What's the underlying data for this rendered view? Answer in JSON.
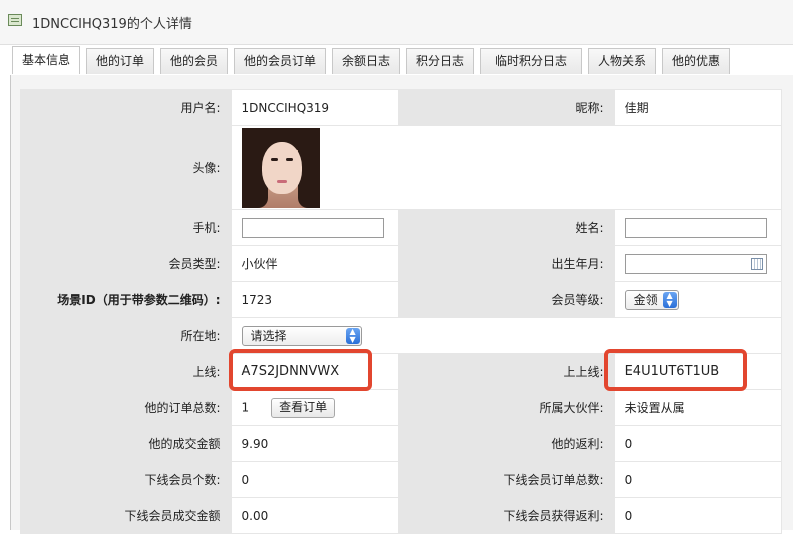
{
  "window": {
    "title": "1DNCCIHQ319的个人详情"
  },
  "tabs": [
    {
      "label": "基本信息"
    },
    {
      "label": "他的订单"
    },
    {
      "label": "他的会员"
    },
    {
      "label": "他的会员订单"
    },
    {
      "label": "余额日志"
    },
    {
      "label": "积分日志"
    },
    {
      "label": "临时积分日志"
    },
    {
      "label": "人物关系"
    },
    {
      "label": "他的优惠"
    }
  ],
  "form": {
    "username_label": "用户名:",
    "username": "1DNCCIHQ319",
    "nickname_label": "昵称:",
    "nickname": "佳期",
    "avatar_label": "头像:",
    "phone_label": "手机:",
    "phone": "",
    "name_label": "姓名:",
    "name": "",
    "type_label": "会员类型:",
    "type": "小伙伴",
    "birth_label": "出生年月:",
    "birth": "",
    "scene_label": "场景ID（用于带参数二维码）:",
    "scene": "1723",
    "level_label": "会员等级:",
    "level": "金领",
    "location_label": "所在地:",
    "location": "请选择",
    "upline_label": "上线:",
    "upline": "A7S2JDNNVWX",
    "upupline_label": "上上线:",
    "upupline": "E4U1UT6T1UB",
    "ordercount_label": "他的订单总数:",
    "ordercount": "1",
    "view_orders": "查看订单",
    "partner_label": "所属大伙伴:",
    "partner": "未设置从属",
    "deal_label": "他的成交金额",
    "deal": "9.90",
    "rebate_label": "他的返利:",
    "rebate": "0",
    "downcount_label": "下线会员个数:",
    "downcount": "0",
    "downorders_label": "下线会员订单总数:",
    "downorders": "0",
    "downdeal_label": "下线会员成交金额",
    "downdeal": "0.00",
    "downrebate_label": "下线会员获得返利:",
    "downrebate": "0"
  },
  "colors": {
    "highlight": "#e2462f",
    "label_bg": "#e6e6e6",
    "select_accent": "#2a6fd8"
  }
}
